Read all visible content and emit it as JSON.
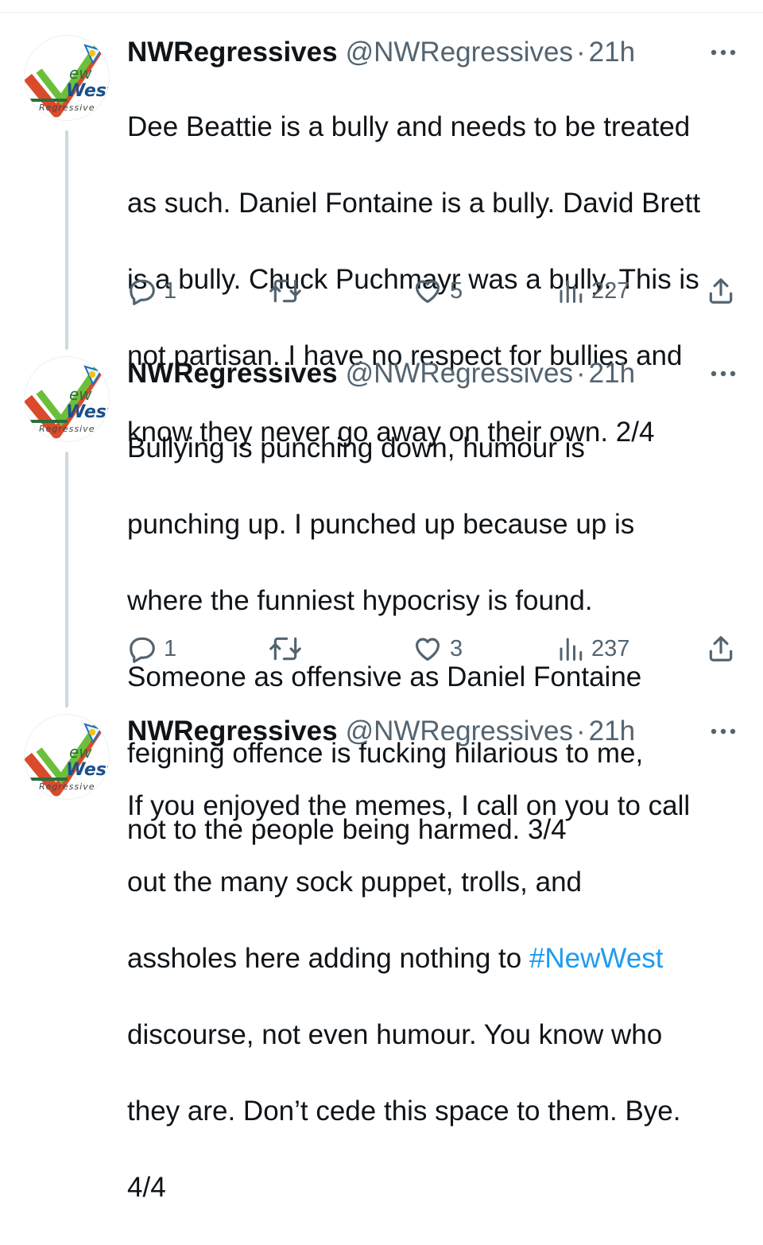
{
  "avatar": {
    "line1": "ew",
    "line2": "West",
    "line3": "Regressive"
  },
  "tweets": [
    {
      "name": "NWRegressives",
      "handle": "@NWRegressives",
      "separator": "·",
      "time": "21h",
      "lines": [
        "Dee Beattie is a bully and needs to be treated",
        "as such. Daniel Fontaine is a bully. David Brett",
        "is a bully. Chuck Puchmayr was a bully. This is",
        "not partisan. I have no respect for bullies and",
        "know they never go away on their own. 2/4"
      ],
      "replies": "1",
      "likes": "5",
      "views": "227"
    },
    {
      "name": "NWRegressives",
      "handle": "@NWRegressives",
      "separator": "·",
      "time": "21h",
      "lines": [
        "Bullying is punching down, humour is",
        "punching up. I punched up because up is",
        "where the funniest hypocrisy is found.",
        "Someone as offensive as Daniel Fontaine",
        "feigning offence is fucking hilarious to me,",
        "not to the people being harmed. 3/4"
      ],
      "replies": "1",
      "likes": "3",
      "views": "237"
    },
    {
      "name": "NWRegressives",
      "handle": "@NWRegressives",
      "separator": "·",
      "time": "21h",
      "lines_before_tag": [
        "If you enjoyed the memes, I call on you to call",
        "out the many sock puppet, trolls, and"
      ],
      "line3_text": "assholes here adding nothing to ",
      "hashtag": "#NewWest",
      "lines_after": [
        "discourse, not even humour. You know who",
        "they are. Don’t cede this space to them. Bye.",
        "4/4"
      ]
    }
  ],
  "colors": {
    "hashtag": "#1d9bf0",
    "secondary": "#536471",
    "thread_line": "#cfd9de"
  }
}
